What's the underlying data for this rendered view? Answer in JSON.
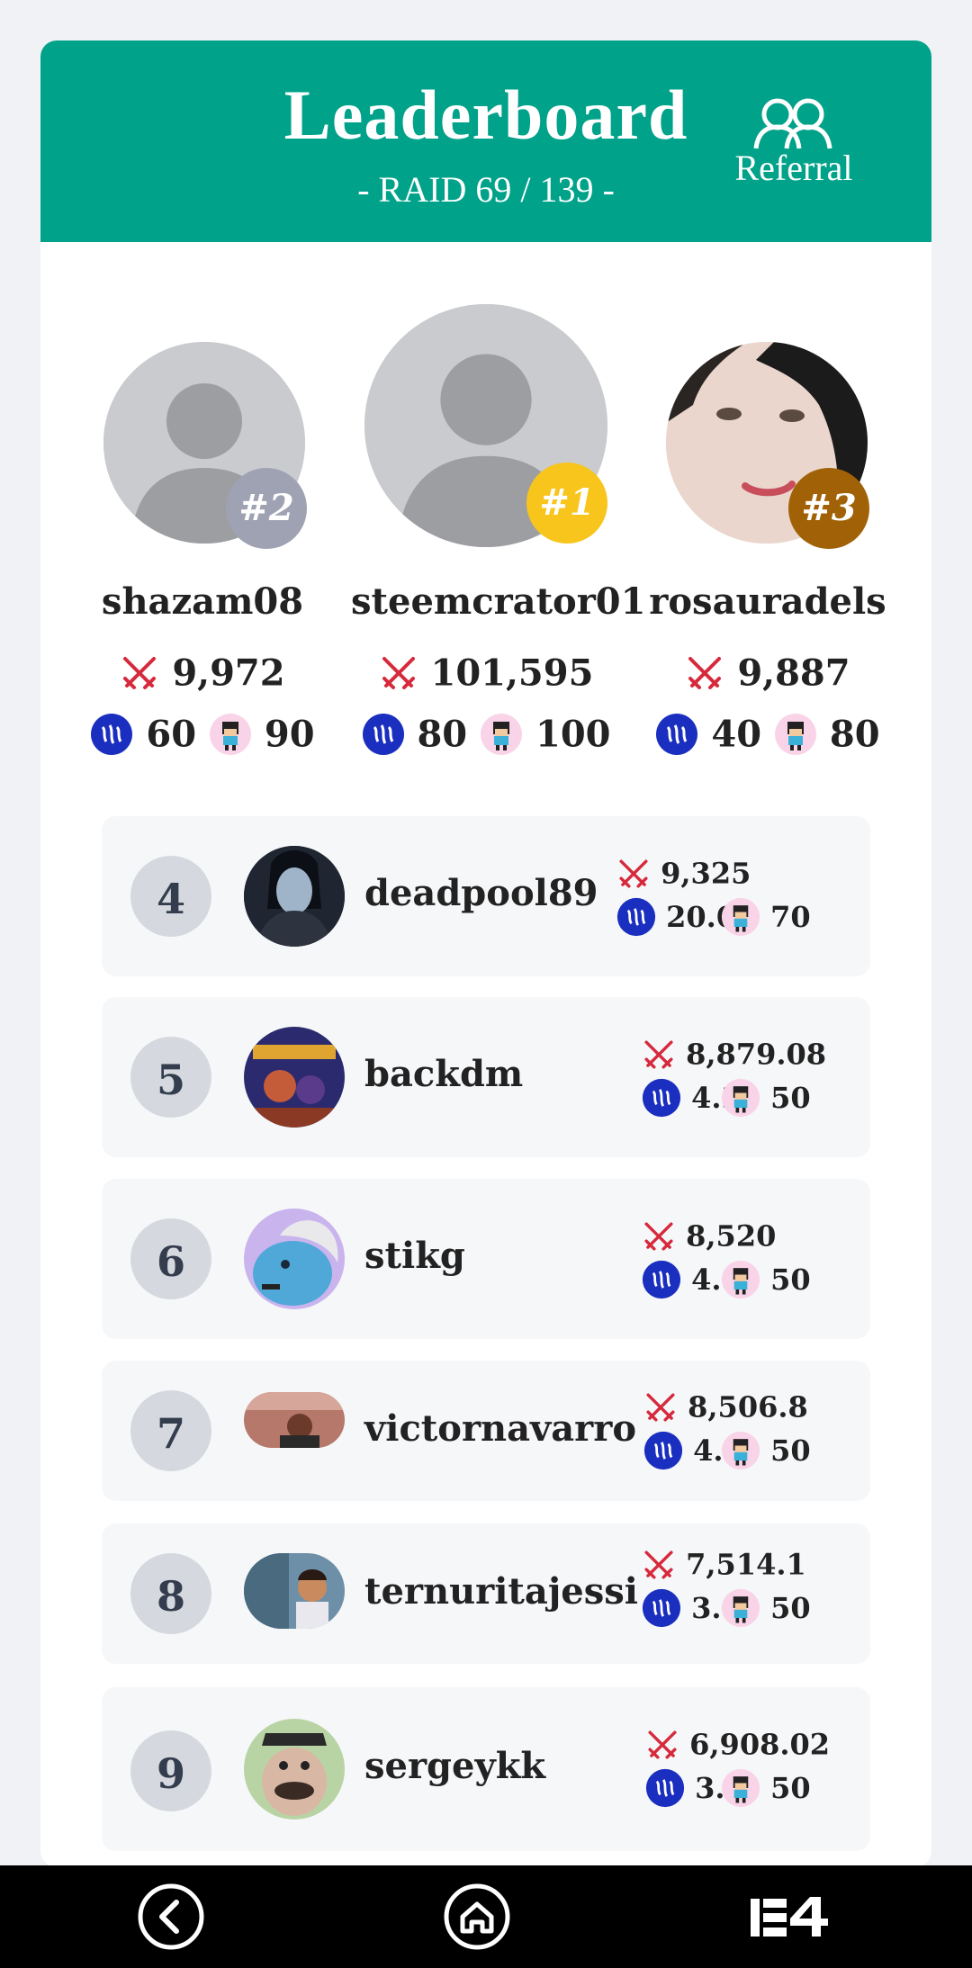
{
  "header": {
    "title": "Leaderboard",
    "subtitle": "- RAID 69 / 139 -",
    "referral_label": "Referral"
  },
  "podium": [
    {
      "rank": "#2",
      "name": "shazam08",
      "power": "9,972",
      "steem": "60",
      "chars": "90",
      "badge_color": "#9fa2b2",
      "avatar": "placeholder"
    },
    {
      "rank": "#1",
      "name": "steemcrator01",
      "power": "101,595",
      "steem": "80",
      "chars": "100",
      "badge_color": "#f8c51c",
      "avatar": "placeholder"
    },
    {
      "rank": "#3",
      "name": "rosauradels",
      "power": "9,887",
      "steem": "40",
      "chars": "80",
      "badge_color": "#a16207",
      "avatar": "photo-woman"
    }
  ],
  "rows": [
    {
      "rank": "4",
      "name": "deadpool89",
      "power": "9,325",
      "steem": "20.0",
      "chars": "70"
    },
    {
      "rank": "5",
      "name": "backdm",
      "power": "8,879.08",
      "steem": "4.3",
      "chars": "50"
    },
    {
      "rank": "6",
      "name": "stikg",
      "power": "8,520",
      "steem": "4.1",
      "chars": "50"
    },
    {
      "rank": "7",
      "name": "victornavarro",
      "power": "8,506.8",
      "steem": "4.1",
      "chars": "50"
    },
    {
      "rank": "8",
      "name": "ternuritajessi",
      "power": "7,514.1",
      "steem": "3.6",
      "chars": "50"
    },
    {
      "rank": "9",
      "name": "sergeykk",
      "power": "6,908.02",
      "steem": "3.3",
      "chars": "50"
    }
  ],
  "icons": {
    "power": "crossed-swords-icon",
    "steem": "steem-coin-icon",
    "chars": "character-icon",
    "referral": "users-icon"
  },
  "colors": {
    "header": "#01a28a",
    "steem_coin": "#1a2fbf",
    "swords": "#d62a3c"
  },
  "navbar": {
    "back": "back-icon",
    "home": "home-icon",
    "app": "app-logo-icon"
  }
}
